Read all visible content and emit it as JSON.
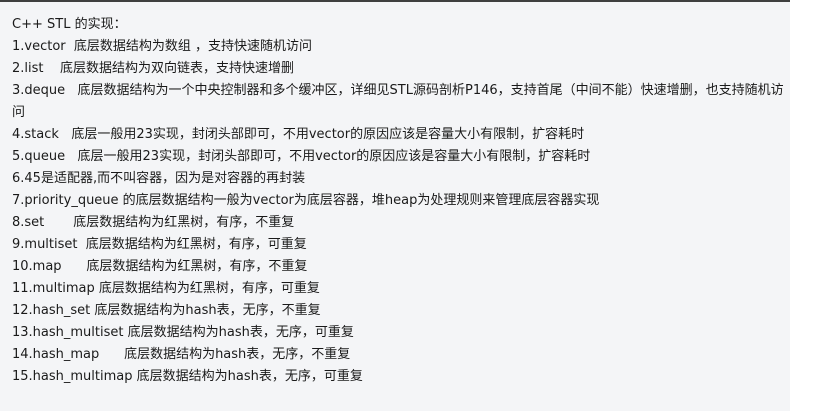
{
  "document": {
    "heading": "C++ STL 的实现：",
    "lines": [
      "1.vector  底层数据结构为数组 ，支持快速随机访问",
      "2.list    底层数据结构为双向链表，支持快速增删",
      "3.deque   底层数据结构为一个中央控制器和多个缓冲区，详细见STL源码剖析P146，支持首尾（中间不能）快速增删，也支持随机访问",
      "4.stack   底层一般用23实现，封闭头部即可，不用vector的原因应该是容量大小有限制，扩容耗时",
      "5.queue   底层一般用23实现，封闭头部即可，不用vector的原因应该是容量大小有限制，扩容耗时",
      "6.45是适配器,而不叫容器，因为是对容器的再封装",
      "7.priority_queue 的底层数据结构一般为vector为底层容器，堆heap为处理规则来管理底层容器实现",
      "8.set       底层数据结构为红黑树，有序，不重复",
      "9.multiset  底层数据结构为红黑树，有序，可重复",
      "10.map      底层数据结构为红黑树，有序，不重复",
      "11.multimap 底层数据结构为红黑树，有序，可重复",
      "12.hash_set 底层数据结构为hash表，无序，不重复",
      "13.hash_multiset 底层数据结构为hash表，无序，可重复",
      "14.hash_map      底层数据结构为hash表，无序，不重复",
      "15.hash_multimap 底层数据结构为hash表，无序，可重复"
    ]
  }
}
